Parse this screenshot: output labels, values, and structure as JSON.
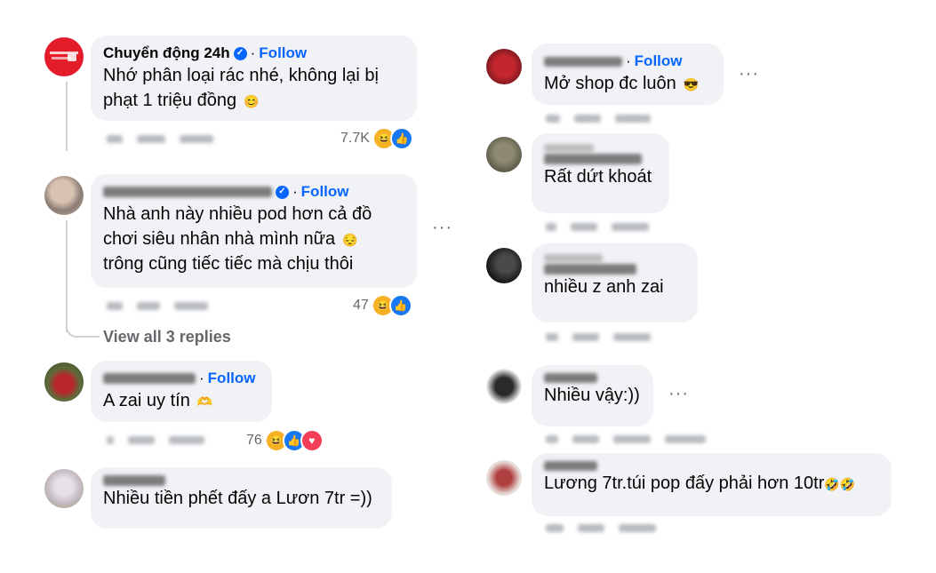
{
  "follow_label": "Follow",
  "left": [
    {
      "name": "Chuyển động 24h",
      "lines": [
        "Nhớ phân loại rác nhé, không lại bị",
        "phạt 1 triệu đồng"
      ],
      "emoji": "😊",
      "reaction_count": "7.7K"
    },
    {
      "lines": [
        "Nhà anh này nhiều pod hơn cả đồ",
        "chơi siêu nhân nhà mình nữa",
        "trông cũng tiếc tiếc mà chịu thôi"
      ],
      "reaction_count": "47",
      "view_replies": "View all 3 replies"
    },
    {
      "lines": [
        "A zai uy tín"
      ],
      "reaction_count": "76"
    },
    {
      "lines": [
        "Nhiều tiền phết đấy a Lươn 7tr =))"
      ]
    }
  ],
  "right": [
    {
      "lines": [
        "Mở shop đc luôn"
      ],
      "emoji": "😎"
    },
    {
      "lines": [
        "Rất dứt khoát"
      ]
    },
    {
      "lines": [
        "nhiều z anh zai"
      ]
    },
    {
      "lines": [
        "Nhiều vậy:))"
      ]
    },
    {
      "lines": [
        "Lương 7tr.túi pop đấy phải hơn 10tr"
      ],
      "emoji": "🤣🤣"
    }
  ],
  "icons": [
    "verified-badge-icon",
    "haha-reaction-icon",
    "like-reaction-icon",
    "love-reaction-icon",
    "more-options-icon"
  ],
  "colors": {
    "follow": "#0866ff",
    "bubble": "#f0f2f5",
    "meta": "#65676b"
  }
}
